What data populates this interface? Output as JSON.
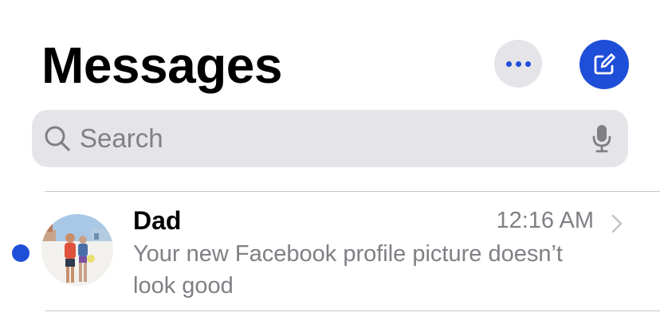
{
  "header": {
    "title": "Messages",
    "more_icon": "ellipsis-icon",
    "compose_icon": "compose-icon"
  },
  "search": {
    "placeholder": "Search",
    "value": "",
    "search_icon": "magnifier-icon",
    "mic_icon": "microphone-icon"
  },
  "conversations": [
    {
      "name": "Dad",
      "time": "12:16 AM",
      "preview": "Your new Facebook profile picture doesn’t look good",
      "unread": true
    }
  ],
  "colors": {
    "accent": "#1f4ed8",
    "button_gray": "#e4e4e9",
    "secondary_text": "#7f7f85"
  }
}
